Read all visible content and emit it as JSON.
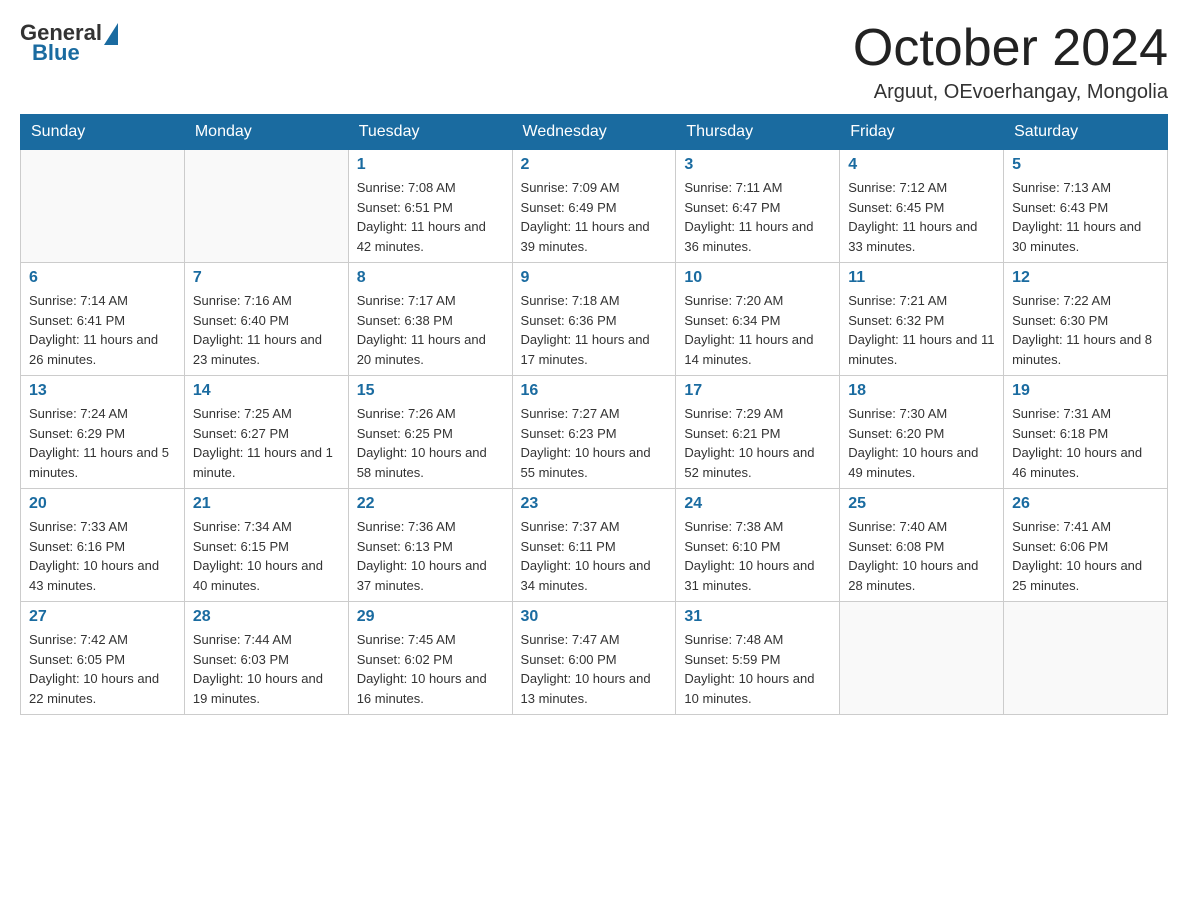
{
  "logo": {
    "general": "General",
    "blue": "Blue"
  },
  "title": "October 2024",
  "location": "Arguut, OEvoerhangay, Mongolia",
  "days_of_week": [
    "Sunday",
    "Monday",
    "Tuesday",
    "Wednesday",
    "Thursday",
    "Friday",
    "Saturday"
  ],
  "weeks": [
    [
      {
        "day": "",
        "info": ""
      },
      {
        "day": "",
        "info": ""
      },
      {
        "day": "1",
        "sunrise": "7:08 AM",
        "sunset": "6:51 PM",
        "daylight": "11 hours and 42 minutes."
      },
      {
        "day": "2",
        "sunrise": "7:09 AM",
        "sunset": "6:49 PM",
        "daylight": "11 hours and 39 minutes."
      },
      {
        "day": "3",
        "sunrise": "7:11 AM",
        "sunset": "6:47 PM",
        "daylight": "11 hours and 36 minutes."
      },
      {
        "day": "4",
        "sunrise": "7:12 AM",
        "sunset": "6:45 PM",
        "daylight": "11 hours and 33 minutes."
      },
      {
        "day": "5",
        "sunrise": "7:13 AM",
        "sunset": "6:43 PM",
        "daylight": "11 hours and 30 minutes."
      }
    ],
    [
      {
        "day": "6",
        "sunrise": "7:14 AM",
        "sunset": "6:41 PM",
        "daylight": "11 hours and 26 minutes."
      },
      {
        "day": "7",
        "sunrise": "7:16 AM",
        "sunset": "6:40 PM",
        "daylight": "11 hours and 23 minutes."
      },
      {
        "day": "8",
        "sunrise": "7:17 AM",
        "sunset": "6:38 PM",
        "daylight": "11 hours and 20 minutes."
      },
      {
        "day": "9",
        "sunrise": "7:18 AM",
        "sunset": "6:36 PM",
        "daylight": "11 hours and 17 minutes."
      },
      {
        "day": "10",
        "sunrise": "7:20 AM",
        "sunset": "6:34 PM",
        "daylight": "11 hours and 14 minutes."
      },
      {
        "day": "11",
        "sunrise": "7:21 AM",
        "sunset": "6:32 PM",
        "daylight": "11 hours and 11 minutes."
      },
      {
        "day": "12",
        "sunrise": "7:22 AM",
        "sunset": "6:30 PM",
        "daylight": "11 hours and 8 minutes."
      }
    ],
    [
      {
        "day": "13",
        "sunrise": "7:24 AM",
        "sunset": "6:29 PM",
        "daylight": "11 hours and 5 minutes."
      },
      {
        "day": "14",
        "sunrise": "7:25 AM",
        "sunset": "6:27 PM",
        "daylight": "11 hours and 1 minute."
      },
      {
        "day": "15",
        "sunrise": "7:26 AM",
        "sunset": "6:25 PM",
        "daylight": "10 hours and 58 minutes."
      },
      {
        "day": "16",
        "sunrise": "7:27 AM",
        "sunset": "6:23 PM",
        "daylight": "10 hours and 55 minutes."
      },
      {
        "day": "17",
        "sunrise": "7:29 AM",
        "sunset": "6:21 PM",
        "daylight": "10 hours and 52 minutes."
      },
      {
        "day": "18",
        "sunrise": "7:30 AM",
        "sunset": "6:20 PM",
        "daylight": "10 hours and 49 minutes."
      },
      {
        "day": "19",
        "sunrise": "7:31 AM",
        "sunset": "6:18 PM",
        "daylight": "10 hours and 46 minutes."
      }
    ],
    [
      {
        "day": "20",
        "sunrise": "7:33 AM",
        "sunset": "6:16 PM",
        "daylight": "10 hours and 43 minutes."
      },
      {
        "day": "21",
        "sunrise": "7:34 AM",
        "sunset": "6:15 PM",
        "daylight": "10 hours and 40 minutes."
      },
      {
        "day": "22",
        "sunrise": "7:36 AM",
        "sunset": "6:13 PM",
        "daylight": "10 hours and 37 minutes."
      },
      {
        "day": "23",
        "sunrise": "7:37 AM",
        "sunset": "6:11 PM",
        "daylight": "10 hours and 34 minutes."
      },
      {
        "day": "24",
        "sunrise": "7:38 AM",
        "sunset": "6:10 PM",
        "daylight": "10 hours and 31 minutes."
      },
      {
        "day": "25",
        "sunrise": "7:40 AM",
        "sunset": "6:08 PM",
        "daylight": "10 hours and 28 minutes."
      },
      {
        "day": "26",
        "sunrise": "7:41 AM",
        "sunset": "6:06 PM",
        "daylight": "10 hours and 25 minutes."
      }
    ],
    [
      {
        "day": "27",
        "sunrise": "7:42 AM",
        "sunset": "6:05 PM",
        "daylight": "10 hours and 22 minutes."
      },
      {
        "day": "28",
        "sunrise": "7:44 AM",
        "sunset": "6:03 PM",
        "daylight": "10 hours and 19 minutes."
      },
      {
        "day": "29",
        "sunrise": "7:45 AM",
        "sunset": "6:02 PM",
        "daylight": "10 hours and 16 minutes."
      },
      {
        "day": "30",
        "sunrise": "7:47 AM",
        "sunset": "6:00 PM",
        "daylight": "10 hours and 13 minutes."
      },
      {
        "day": "31",
        "sunrise": "7:48 AM",
        "sunset": "5:59 PM",
        "daylight": "10 hours and 10 minutes."
      },
      {
        "day": "",
        "info": ""
      },
      {
        "day": "",
        "info": ""
      }
    ]
  ]
}
